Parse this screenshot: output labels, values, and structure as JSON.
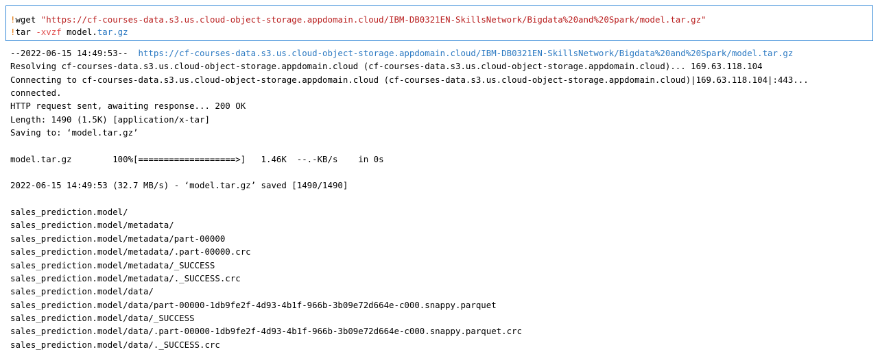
{
  "input": {
    "line1": {
      "bang": "!",
      "cmd": "wget ",
      "url": "\"https://cf-courses-data.s3.us.cloud-object-storage.appdomain.cloud/IBM-DB0321EN-SkillsNetwork/Bigdata%20and%20Spark/model.tar.gz\""
    },
    "line2": {
      "bang": "!",
      "cmd": "tar ",
      "flag": "-xvzf",
      "file_prefix": " model.",
      "file_suffix": "tar.gz"
    }
  },
  "output": {
    "first_prefix": "--2022-06-15 14:49:53--  ",
    "first_url": "https://cf-courses-data.s3.us.cloud-object-storage.appdomain.cloud/IBM-DB0321EN-SkillsNetwork/Bigdata%20and%20Spark/model.tar.gz",
    "lines": [
      "Resolving cf-courses-data.s3.us.cloud-object-storage.appdomain.cloud (cf-courses-data.s3.us.cloud-object-storage.appdomain.cloud)... 169.63.118.104",
      "Connecting to cf-courses-data.s3.us.cloud-object-storage.appdomain.cloud (cf-courses-data.s3.us.cloud-object-storage.appdomain.cloud)|169.63.118.104|:443...",
      "connected.",
      "HTTP request sent, awaiting response... 200 OK",
      "Length: 1490 (1.5K) [application/x-tar]",
      "Saving to: ‘model.tar.gz’",
      "",
      "model.tar.gz        100%[===================>]   1.46K  --.-KB/s    in 0s",
      "",
      "2022-06-15 14:49:53 (32.7 MB/s) - ‘model.tar.gz’ saved [1490/1490]",
      "",
      "sales_prediction.model/",
      "sales_prediction.model/metadata/",
      "sales_prediction.model/metadata/part-00000",
      "sales_prediction.model/metadata/.part-00000.crc",
      "sales_prediction.model/metadata/_SUCCESS",
      "sales_prediction.model/metadata/._SUCCESS.crc",
      "sales_prediction.model/data/",
      "sales_prediction.model/data/part-00000-1db9fe2f-4d93-4b1f-966b-3b09e72d664e-c000.snappy.parquet",
      "sales_prediction.model/data/_SUCCESS",
      "sales_prediction.model/data/.part-00000-1db9fe2f-4d93-4b1f-966b-3b09e72d664e-c000.snappy.parquet.crc",
      "sales_prediction.model/data/._SUCCESS.crc"
    ]
  },
  "colors": {
    "cell_border": "#2e86d6",
    "bang": "#e07000",
    "string": "#ba2121",
    "flag": "#e05050",
    "attribute": "#2b79c2",
    "link": "#2b79c2"
  }
}
